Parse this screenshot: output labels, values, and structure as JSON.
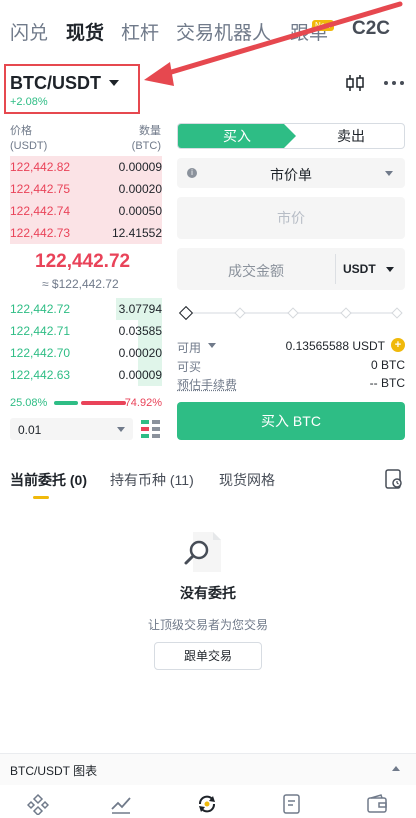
{
  "top_tabs": [
    {
      "label": "闪兑",
      "active": false
    },
    {
      "label": "现货",
      "active": true
    },
    {
      "label": "杠杆",
      "active": false
    },
    {
      "label": "交易机器人",
      "active": false
    },
    {
      "label": "跟单",
      "active": false,
      "badge": "New"
    },
    {
      "label": "C2C",
      "active": false
    }
  ],
  "header": {
    "pair": "BTC/USDT",
    "change": "+2.08%",
    "icons": [
      "candlestick-chart-icon",
      "more-icon"
    ],
    "annotation_color": "#e6484f"
  },
  "orderbook": {
    "price_header": [
      "价格",
      "(USDT)"
    ],
    "qty_header": [
      "数量",
      "(BTC)"
    ],
    "asks": [
      {
        "price": "122,442.82",
        "qty": "0.00009",
        "depth": 0.15
      },
      {
        "price": "122,442.75",
        "qty": "0.00020",
        "depth": 0.15
      },
      {
        "price": "122,442.74",
        "qty": "0.00050",
        "depth": 0.15
      },
      {
        "price": "122,442.73",
        "qty": "12.41552",
        "depth": 0.15
      }
    ],
    "last_price": "122,442.72",
    "last_price_usd": "≈ $122,442.72",
    "bids": [
      {
        "price": "122,442.72",
        "qty": "3.07794",
        "depth": 0.3
      },
      {
        "price": "122,442.71",
        "qty": "0.03585",
        "depth": 0.16
      },
      {
        "price": "122,442.70",
        "qty": "0.00020",
        "depth": 0.16
      },
      {
        "price": "122,442.63",
        "qty": "0.00009",
        "depth": 0.16
      }
    ],
    "buy_ratio": "25.08%",
    "sell_ratio": "74.92%",
    "precision": "0.01"
  },
  "trade": {
    "buy_label": "买入",
    "sell_label": "卖出",
    "order_type": "市价单",
    "price_placeholder": "市价",
    "amount_placeholder": "成交金额",
    "amount_unit": "USDT",
    "available_label": "可用",
    "available_value": "0.13565588 USDT",
    "can_buy_label": "可买",
    "can_buy_value": "0 BTC",
    "fee_label": "预估手续费",
    "fee_value": "-- BTC",
    "submit_label": "买入 BTC"
  },
  "orders": {
    "tabs": [
      "当前委托 (0)",
      "持有币种 (11)",
      "现货网格"
    ],
    "empty_title": "没有委托",
    "empty_sub": "让顶级交易者为您交易",
    "copy_button": "跟单交易"
  },
  "chart_bar": {
    "label": "BTC/USDT 图表"
  },
  "colors": {
    "buy": "#2ebd85",
    "sell": "#e94359",
    "brand": "#f0b90b"
  },
  "bottom_nav_icons": [
    "home-icon",
    "markets-icon",
    "trade-icon",
    "futures-icon",
    "wallet-icon"
  ]
}
